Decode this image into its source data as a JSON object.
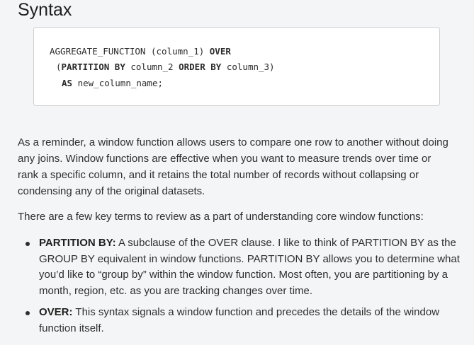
{
  "heading": "Syntax",
  "code": {
    "line1": {
      "kw1": "",
      "text1": "AGGREGATE_FUNCTION (column_1) ",
      "kw2": "OVER"
    },
    "line2": {
      "open": "(",
      "kw1": "PARTITION BY",
      "text1": " column_2 ",
      "kw2": "ORDER BY",
      "text2": " column_3)"
    },
    "line3": {
      "kw1": "AS",
      "text1": " new_column_name;"
    }
  },
  "paragraphs": [
    "As a reminder, a window function allows users to compare one row to another without doing any joins. Window functions are effective when you want to measure trends over time or rank a specific column, and it retains the total number of records without collapsing or condensing any of the original datasets.",
    "There are a few key terms to review as a part of understanding core window functions:"
  ],
  "bullets": [
    {
      "term": "PARTITION BY:",
      "text": " A subclause of the OVER clause. I like to think of PARTITION BY as the GROUP BY equivalent in window functions. PARTITION BY allows you to determine what you’d like to “group by” within the window function. Most often, you are partitioning by a month, region, etc. as you are tracking changes over time."
    },
    {
      "term": "OVER:",
      "text": " This syntax signals a window function and precedes the details of the window function itself."
    }
  ]
}
